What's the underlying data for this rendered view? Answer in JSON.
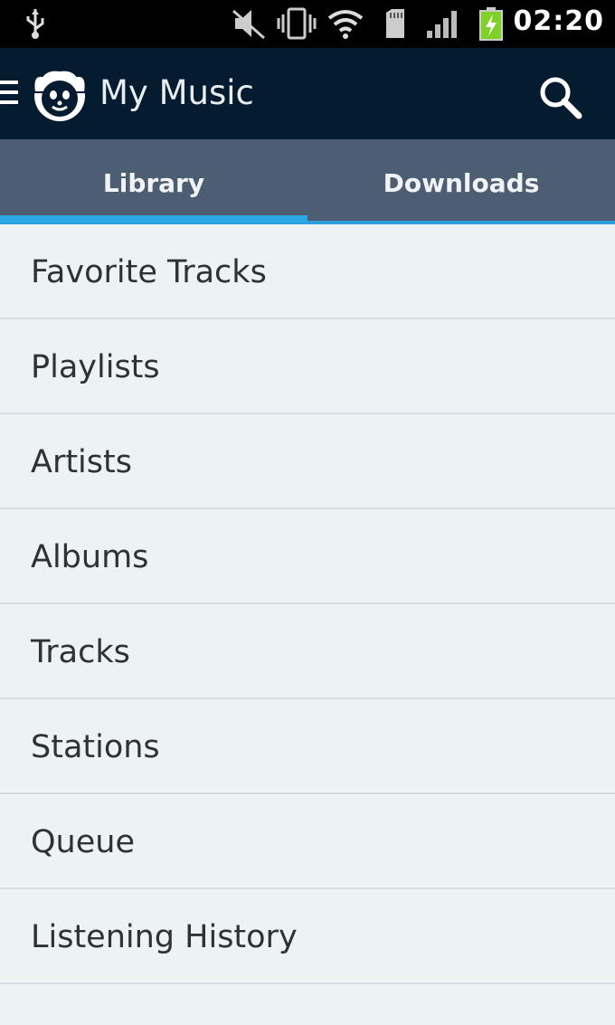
{
  "status_bar": {
    "time": "02:20",
    "icons": [
      "usb-icon",
      "mute-icon",
      "vibrate-icon",
      "wifi-icon",
      "sd-card-icon",
      "signal-icon",
      "battery-charging-icon"
    ]
  },
  "app_bar": {
    "title": "My Music",
    "icons": [
      "menu-icon",
      "napster-logo",
      "search-icon"
    ]
  },
  "tabs": [
    {
      "label": "Library",
      "selected": true
    },
    {
      "label": "Downloads",
      "selected": false
    }
  ],
  "library_items": [
    {
      "label": "Favorite Tracks"
    },
    {
      "label": "Playlists"
    },
    {
      "label": "Artists"
    },
    {
      "label": "Albums"
    },
    {
      "label": "Tracks"
    },
    {
      "label": "Stations"
    },
    {
      "label": "Queue"
    },
    {
      "label": "Listening History"
    }
  ],
  "colors": {
    "app_bar": "#041b30",
    "tab_bar": "#4d5d72",
    "tab_indicator": "#2aa8e6",
    "list_background": "#edf2f5"
  }
}
